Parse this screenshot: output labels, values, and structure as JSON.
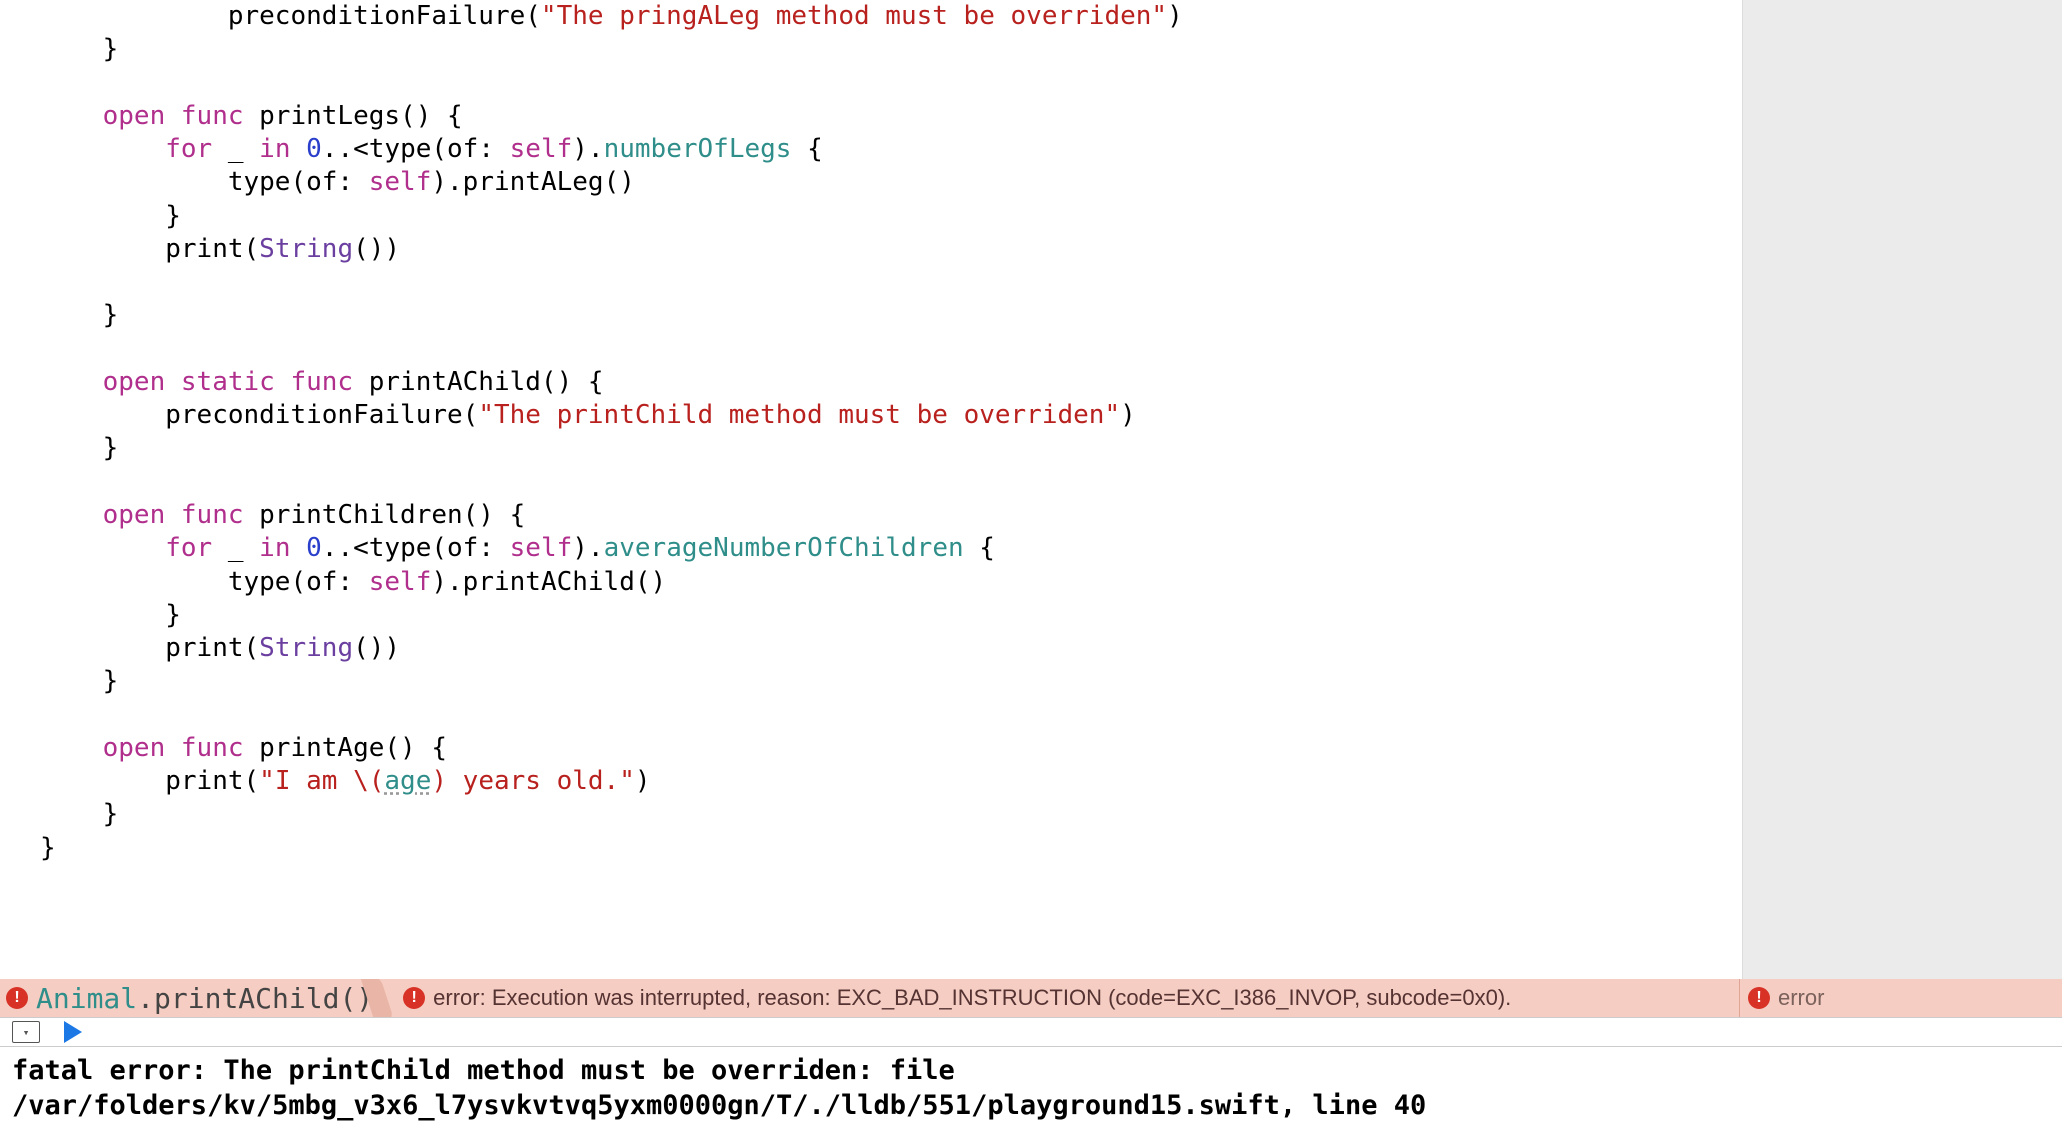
{
  "code": {
    "line1_prefix": "            ",
    "line1_fn": "preconditionFailure",
    "line1_str": "\"The pringALeg method must be overriden\"",
    "line2": "    }",
    "blank": "",
    "printLegs_sig_open": "    open",
    "func_kw": " func ",
    "printLegs_name": "printLegs",
    "paren_brace": "() {",
    "for_line_indent": "        ",
    "for_kw": "for",
    "underscore": " _ ",
    "in_kw": "in",
    "zero": " 0",
    "range": "..<",
    "type_call": "type(of: ",
    "self_kw": "self",
    "close_paren_dot": ").",
    "numberOfLegs": "numberOfLegs",
    "brace": " {",
    "inner_indent": "            ",
    "printALeg": "printALeg",
    "call_suffix": "()",
    "close_inner": "        }",
    "print_line_indent": "        ",
    "print_fn": "print",
    "string_type": "String",
    "empty_call": "()",
    "close_method": "    }",
    "printAChild_static": "    open static func ",
    "printAChild_name": "printAChild",
    "preFail2_indent": "        ",
    "preFail2_str": "\"The printChild method must be overriden\"",
    "printChildren_name": "printChildren",
    "avgChildren": "averageNumberOfChildren",
    "printAChild_call": "printAChild",
    "printAge_name": "printAge",
    "age_str_pre": "\"I am \\(",
    "age_id": "age",
    "age_str_post": ") years old.\"",
    "final_brace": "}"
  },
  "error_bar": {
    "location_class": "Animal",
    "location_method": "printAChild()",
    "main_text": "error: Execution was interrupted, reason: EXC_BAD_INSTRUCTION (code=EXC_I386_INVOP, subcode=0x0).",
    "right_text": "error"
  },
  "console": {
    "line": "fatal error: The printChild method must be overriden: file /var/folders/kv/5mbg_v3x6_l7ysvkvtvq5yxm0000gn/T/./lldb/551/playground15.swift, line 40"
  }
}
